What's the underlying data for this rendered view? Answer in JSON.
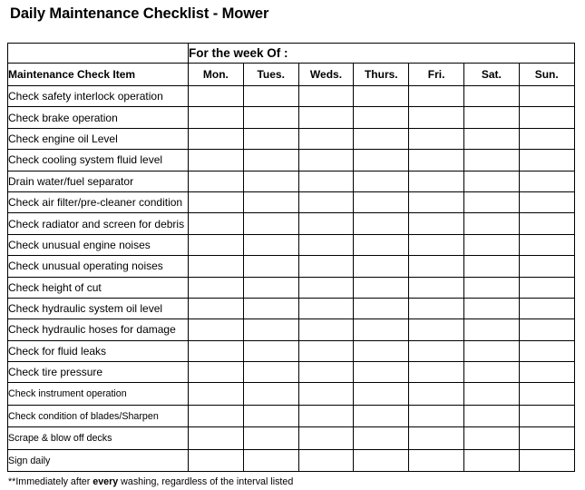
{
  "document": {
    "title": "Daily Maintenance Checklist - Mower",
    "footnote": {
      "prefix": "**Immediately after ",
      "emphasis": "every",
      "suffix": " washing, regardless of the interval listed"
    }
  },
  "table": {
    "week_header": "For the week Of :",
    "item_column_header": "Maintenance Check Item",
    "day_columns": [
      "Mon.",
      "Tues.",
      "Weds.",
      "Thurs.",
      "Fri.",
      "Sat.",
      "Sun."
    ],
    "rows": [
      {
        "label": "Check safety interlock operation",
        "small": false,
        "heavy": false
      },
      {
        "label": "Check brake operation",
        "small": false,
        "heavy": true
      },
      {
        "label": "Check engine oil Level",
        "small": false,
        "heavy": false
      },
      {
        "label": "Check cooling system fluid level",
        "small": false,
        "heavy": false
      },
      {
        "label": "Drain water/fuel separator",
        "small": false,
        "heavy": true
      },
      {
        "label": "Check air filter/pre-cleaner condition",
        "small": false,
        "heavy": false
      },
      {
        "label": "Check radiator and screen for debris",
        "small": false,
        "heavy": false
      },
      {
        "label": "Check unusual engine noises",
        "small": false,
        "heavy": true
      },
      {
        "label": "Check unusual operating noises",
        "small": false,
        "heavy": false
      },
      {
        "label": "Check height of cut",
        "small": false,
        "heavy": false
      },
      {
        "label": "Check hydraulic system oil level",
        "small": false,
        "heavy": true
      },
      {
        "label": "Check hydraulic hoses for damage",
        "small": false,
        "heavy": false
      },
      {
        "label": "Check for fluid leaks",
        "small": false,
        "heavy": false
      },
      {
        "label": "Check tire pressure",
        "small": false,
        "heavy": true
      },
      {
        "label": "Check instrument operation",
        "small": true,
        "heavy": false
      },
      {
        "label": "Check condition of blades/Sharpen",
        "small": true,
        "heavy": false
      },
      {
        "label": "Scrape & blow off decks",
        "small": true,
        "heavy": true
      },
      {
        "label": "Sign daily",
        "small": true,
        "heavy": false
      }
    ]
  }
}
